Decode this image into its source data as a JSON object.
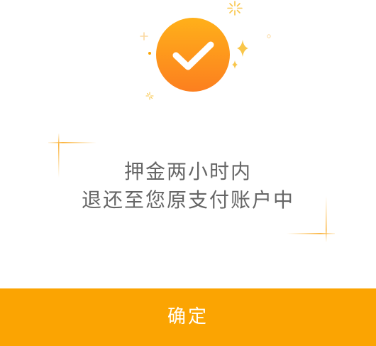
{
  "dialog": {
    "icon": "check-circle-icon",
    "message_line1": "押金两小时内",
    "message_line2": "退还至您原支付账户中",
    "confirm_label": "确定"
  },
  "colors": {
    "accent": "#FBA402",
    "badge_top": "#FFB21A",
    "badge_bottom": "#FC7F1F",
    "text": "#666666",
    "sparkle": "#F9C64A",
    "sparkle_light": "#FBD9A0"
  }
}
